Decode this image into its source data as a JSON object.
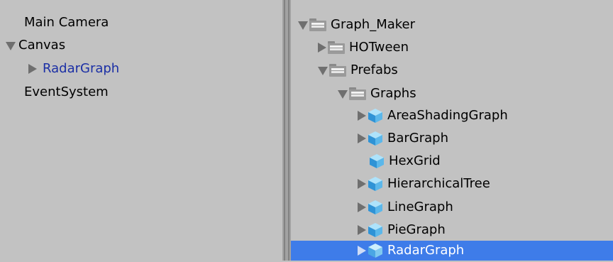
{
  "hierarchy": {
    "items": [
      {
        "label": "Main Camera",
        "arrow": "none"
      },
      {
        "label": "Canvas",
        "arrow": "down"
      },
      {
        "label": "RadarGraph",
        "arrow": "right"
      },
      {
        "label": "EventSystem",
        "arrow": "none"
      }
    ]
  },
  "project": {
    "items": [
      {
        "label": "Graph_Maker",
        "arrow": "down",
        "icon": "folder-icon"
      },
      {
        "label": "HOTween",
        "arrow": "right",
        "icon": "folder-icon"
      },
      {
        "label": "Prefabs",
        "arrow": "down",
        "icon": "folder-icon"
      },
      {
        "label": "Graphs",
        "arrow": "down",
        "icon": "folder-icon"
      },
      {
        "label": "AreaShadingGraph",
        "arrow": "right",
        "icon": "prefab-cube-icon"
      },
      {
        "label": "BarGraph",
        "arrow": "right",
        "icon": "prefab-cube-icon"
      },
      {
        "label": "HexGrid",
        "arrow": "none",
        "icon": "prefab-cube-icon"
      },
      {
        "label": "HierarchicalTree",
        "arrow": "right",
        "icon": "prefab-cube-icon"
      },
      {
        "label": "LineGraph",
        "arrow": "right",
        "icon": "prefab-cube-icon"
      },
      {
        "label": "PieGraph",
        "arrow": "right",
        "icon": "prefab-cube-icon"
      },
      {
        "label": "RadarGraph",
        "arrow": "right",
        "icon": "prefab-cube-icon",
        "selected": true
      }
    ]
  },
  "colors": {
    "panel_bg": "#c2c2c2",
    "selection": "#3e7ce9",
    "prefab_instance_text": "#1b2fa5",
    "splitter": "#a2a2a2"
  }
}
